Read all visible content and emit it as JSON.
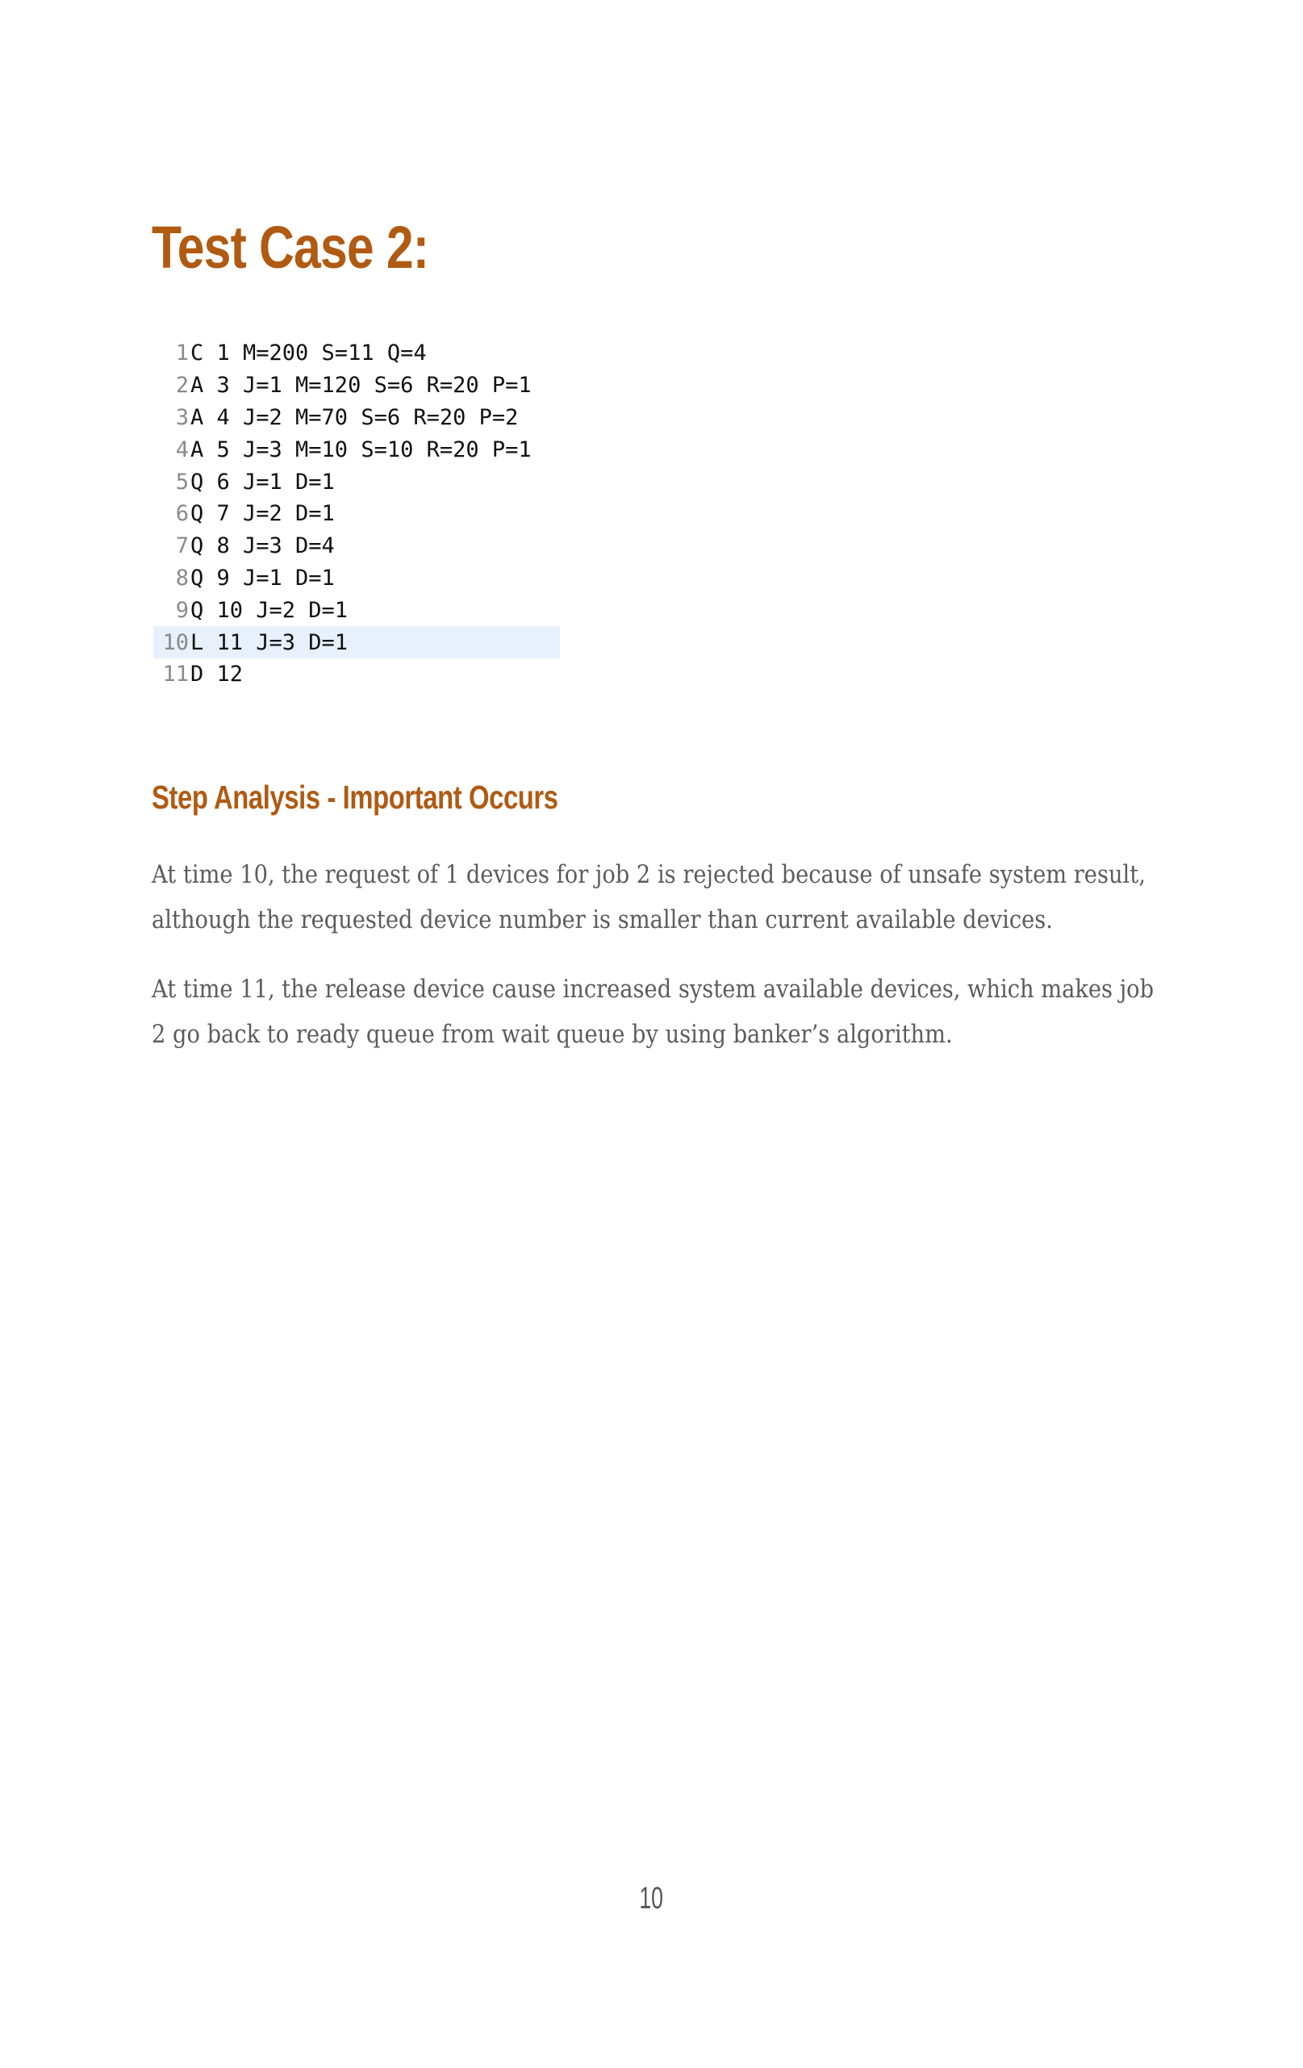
{
  "title": "Test Case 2:",
  "code": {
    "lines": [
      {
        "no": "1",
        "text": "C 1 M=200 S=11 Q=4"
      },
      {
        "no": "2",
        "text": "A 3 J=1 M=120 S=6 R=20 P=1"
      },
      {
        "no": "3",
        "text": "A 4 J=2 M=70 S=6 R=20 P=2"
      },
      {
        "no": "4",
        "text": "A 5 J=3 M=10 S=10 R=20 P=1"
      },
      {
        "no": "5",
        "text": "Q 6 J=1 D=1"
      },
      {
        "no": "6",
        "text": "Q 7 J=2 D=1"
      },
      {
        "no": "7",
        "text": "Q 8 J=3 D=4"
      },
      {
        "no": "8",
        "text": "Q 9 J=1 D=1"
      },
      {
        "no": "9",
        "text": "Q 10 J=2 D=1"
      },
      {
        "no": "10",
        "text": "L 11 J=3 D=1"
      },
      {
        "no": "11",
        "text": "D 12"
      }
    ]
  },
  "section": {
    "heading": "Step Analysis - Important Occurs",
    "paragraphs": [
      "At time 10, the request of 1 devices for job 2 is rejected because of unsafe system result, although the requested device number is smaller than current available devices.",
      "At time 11, the release device cause increased system available devices, which makes job 2 go back to ready queue from wait queue by using banker’s algorithm."
    ]
  },
  "page_number": "10",
  "colors": {
    "heading": "#b05a12",
    "body_text": "#5c5c5c",
    "line_highlight": "#e7f0fb"
  }
}
